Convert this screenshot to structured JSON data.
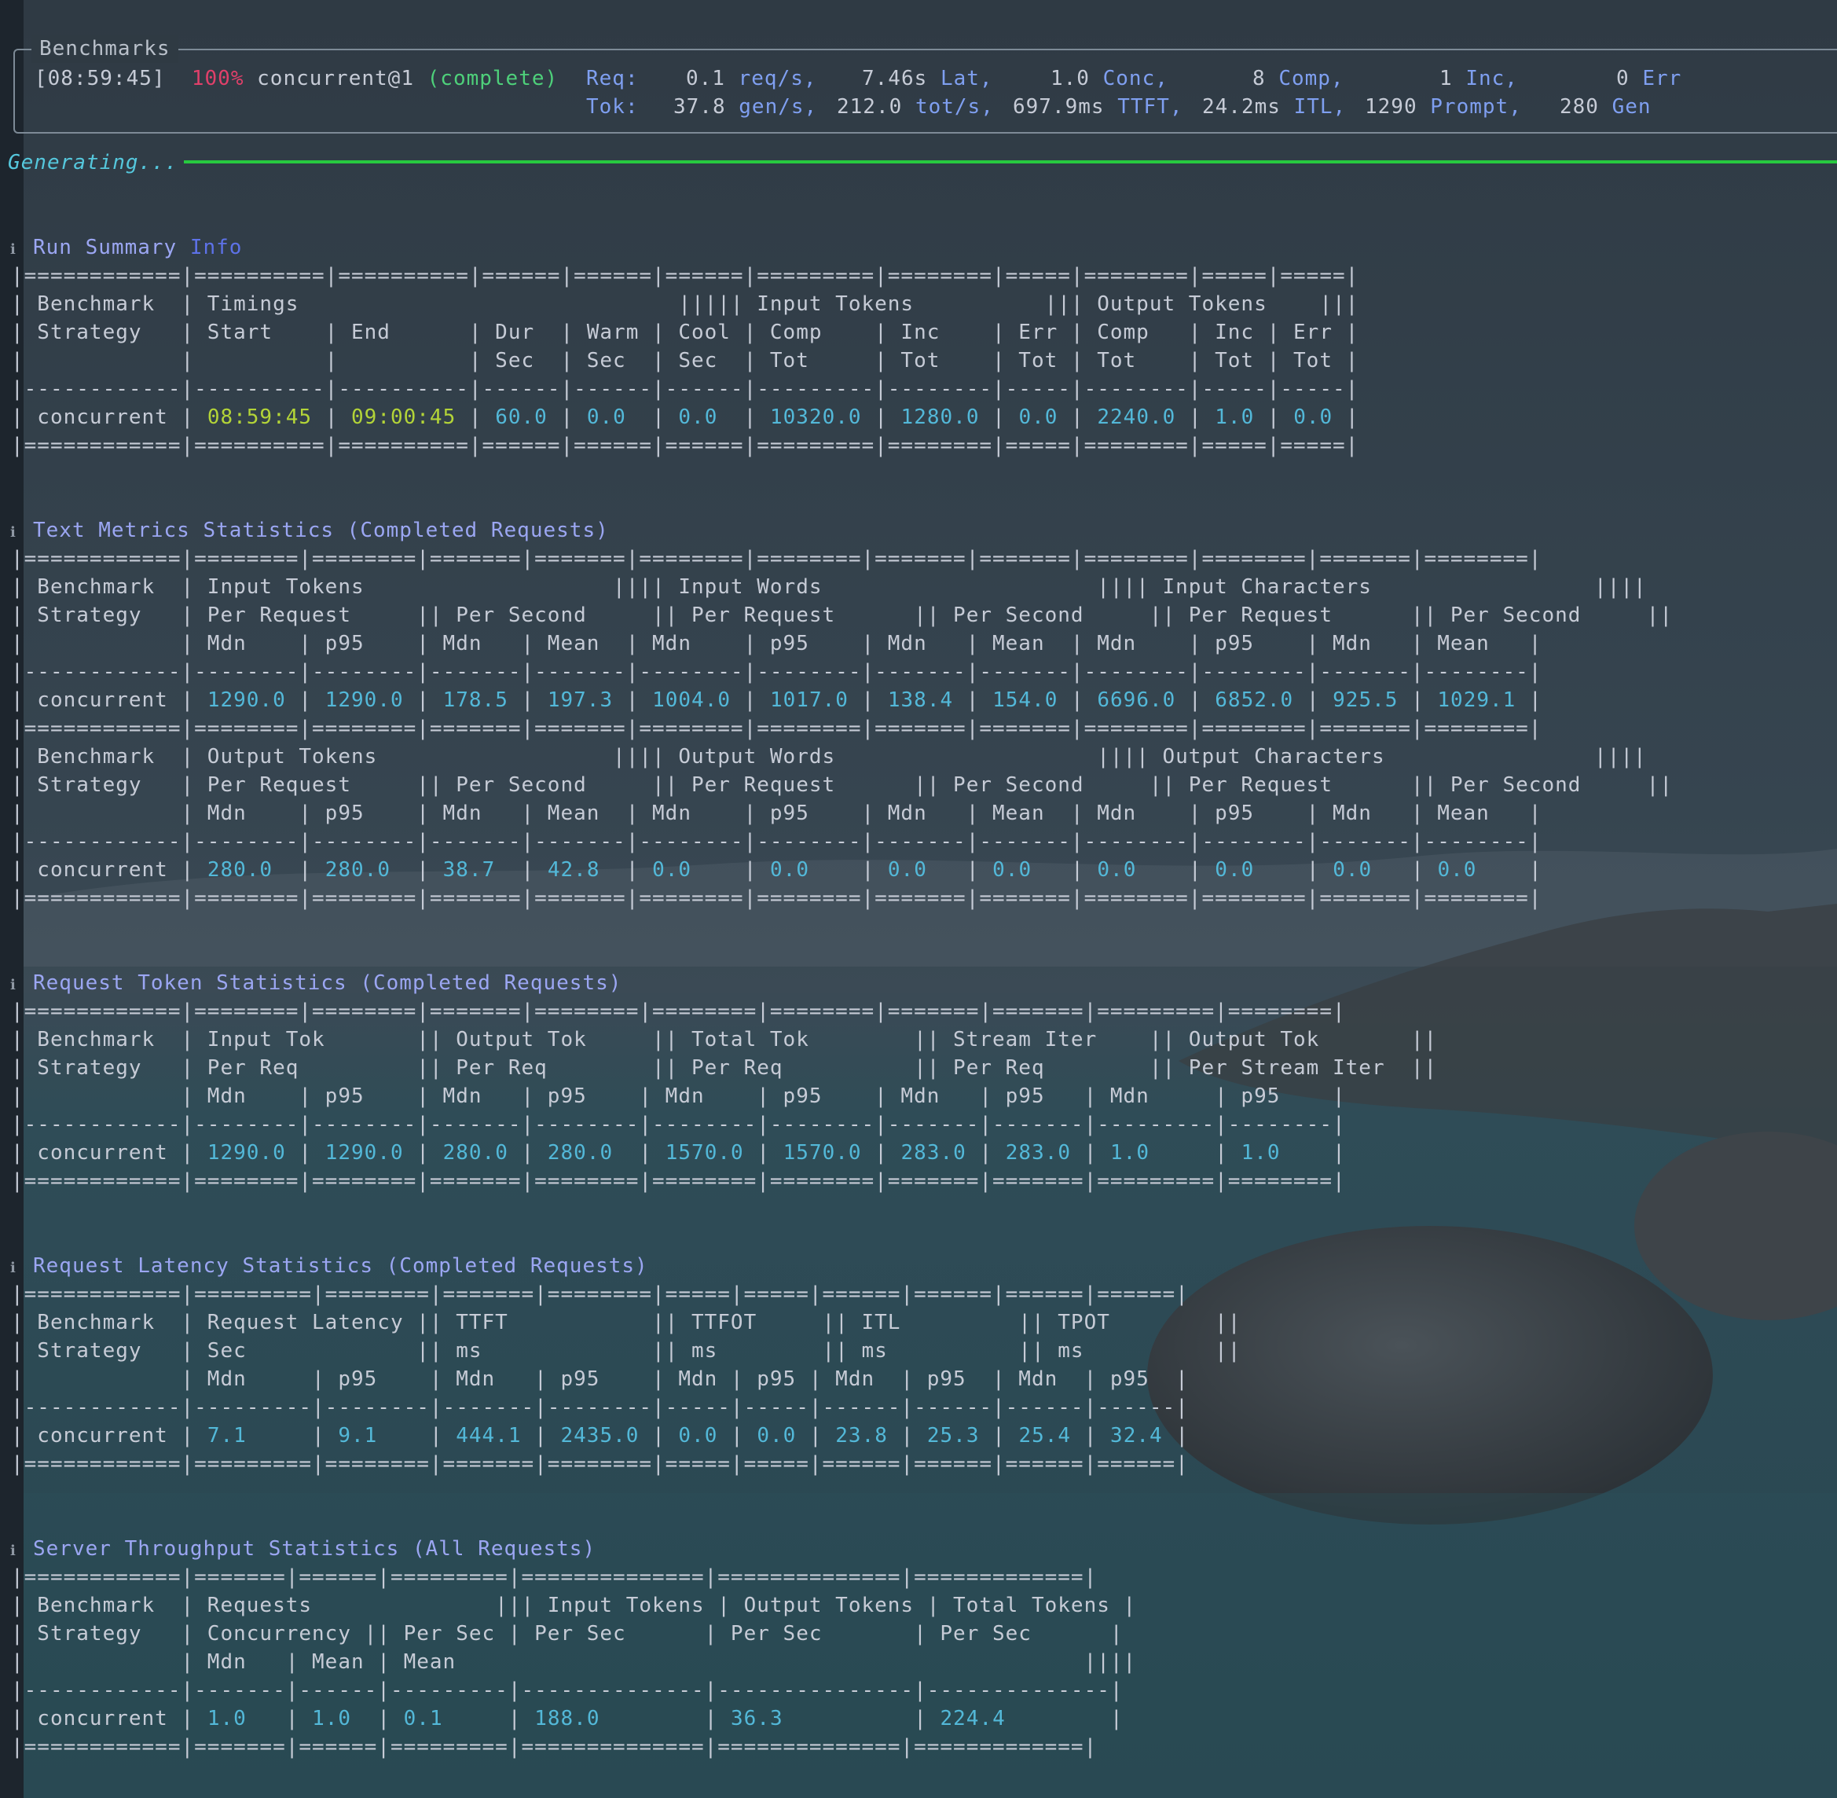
{
  "benchmarks_panel": {
    "title": "Benchmarks",
    "timestamp": "[08:59:45]",
    "progress": "100%",
    "strategy": "concurrent@1",
    "status": "(complete)",
    "req_label": "Req:",
    "req_rate_value": "0.1",
    "req_rate_unit": "req/s,",
    "lat_value": "7.46s",
    "lat_unit": "Lat,",
    "conc_value": "1.0",
    "conc_unit": "Conc,",
    "comp_value": "8",
    "comp_unit": "Comp,",
    "inc_value": "1",
    "inc_unit": "Inc,",
    "err_value": "0",
    "err_unit": "Err",
    "tok_label": "Tok:",
    "gen_rate_value": "37.8",
    "gen_rate_unit": "gen/s,",
    "tot_rate_value": "212.0",
    "tot_rate_unit": "tot/s,",
    "ttft_value": "697.9ms",
    "ttft_unit": "TTFT,",
    "itl_value": "24.2ms",
    "itl_unit": "ITL,",
    "prompt_value": "1290",
    "prompt_unit": "Prompt,",
    "gen_value": "280",
    "gen_unit": "Gen"
  },
  "generating_label": "Generating...",
  "icons": {
    "info": "info-icon"
  },
  "colors": {
    "value": "#53b8d8",
    "time": "#b3d438",
    "title": "#9ba6f2",
    "progress_red": "#e0406a",
    "status_green": "#4ed07a",
    "progress_bar": "#27c93f"
  },
  "sections": {
    "run_summary": {
      "title": "Run Summary",
      "title_suffix": "Info"
    },
    "text_metrics": {
      "title": "Text Metrics Statistics (Completed Requests)"
    },
    "request_tokens": {
      "title": "Request Token Statistics (Completed Requests)"
    },
    "request_latency": {
      "title": "Request Latency Statistics (Completed Requests)"
    },
    "server_throughput": {
      "title": "Server Throughput Statistics (All Requests)"
    }
  },
  "tables": {
    "run_summary": [
      "|============|==========|==========|======|======|======|=========|========|=====|========|=====|=====|",
      "| Benchmark  | Timings                             ||||| Input Tokens          ||| Output Tokens    |||",
      "| Strategy   | Start    | End      | Dur  | Warm | Cool | Comp    | Inc    | Err | Comp   | Inc | Err |",
      "|            |          |          | Sec  | Sec  | Sec  | Tot     | Tot    | Tot | Tot    | Tot | Tot |",
      "|------------|----------|----------|------|------|------|---------|--------|-----|--------|-----|-----|",
      "| concurrent | 08:59:45 | 09:00:45 | 60.0 | 0.0  | 0.0  | 10320.0 | 1280.0 | 0.0 | 2240.0 | 1.0 | 0.0 |",
      "|============|==========|==========|======|======|======|=========|========|=====|========|=====|=====|"
    ],
    "text_metrics": [
      "|============|========|========|=======|=======|========|========|=======|=======|========|========|=======|========|",
      "| Benchmark  | Input Tokens                   |||| Input Words                     |||| Input Characters                 ||||",
      "| Strategy   | Per Request     || Per Second     || Per Request      || Per Second     || Per Request      || Per Second     ||",
      "|            | Mdn    | p95    | Mdn   | Mean  | Mdn    | p95    | Mdn   | Mean  | Mdn    | p95    | Mdn   | Mean   |",
      "|------------|--------|--------|-------|-------|--------|--------|-------|-------|--------|--------|-------|--------|",
      "| concurrent | 1290.0 | 1290.0 | 178.5 | 197.3 | 1004.0 | 1017.0 | 138.4 | 154.0 | 6696.0 | 6852.0 | 925.5 | 1029.1 |",
      "|============|========|========|=======|=======|========|========|=======|=======|========|========|=======|========|",
      "| Benchmark  | Output Tokens                  |||| Output Words                    |||| Output Characters                ||||",
      "| Strategy   | Per Request     || Per Second     || Per Request      || Per Second     || Per Request      || Per Second     ||",
      "|            | Mdn    | p95    | Mdn   | Mean  | Mdn    | p95    | Mdn   | Mean  | Mdn    | p95    | Mdn   | Mean   |",
      "|------------|--------|--------|-------|-------|--------|--------|-------|-------|--------|--------|-------|--------|",
      "| concurrent | 280.0  | 280.0  | 38.7  | 42.8  | 0.0    | 0.0    | 0.0   | 0.0   | 0.0    | 0.0    | 0.0   | 0.0    |",
      "|============|========|========|=======|=======|========|========|=======|=======|========|========|=======|========|"
    ],
    "request_tokens": [
      "|============|========|========|=======|========|========|========|=======|=======|=========|========|",
      "| Benchmark  | Input Tok       || Output Tok     || Total Tok        || Stream Iter    || Output Tok       ||",
      "| Strategy   | Per Req         || Per Req        || Per Req          || Per Req        || Per Stream Iter  ||",
      "|            | Mdn    | p95    | Mdn   | p95    | Mdn    | p95    | Mdn   | p95   | Mdn     | p95    |",
      "|------------|--------|--------|-------|--------|--------|--------|-------|-------|---------|--------|",
      "| concurrent | 1290.0 | 1290.0 | 280.0 | 280.0  | 1570.0 | 1570.0 | 283.0 | 283.0 | 1.0     | 1.0    |",
      "|============|========|========|=======|========|========|========|=======|=======|=========|========|"
    ],
    "request_latency": [
      "|============|=========|========|=======|========|=====|=====|======|======|======|======|",
      "| Benchmark  | Request Latency || TTFT           || TTFOT     || ITL         || TPOT        ||",
      "| Strategy   | Sec             || ms             || ms        || ms          || ms          ||",
      "|            | Mdn     | p95    | Mdn   | p95    | Mdn | p95 | Mdn  | p95  | Mdn  | p95  |",
      "|------------|---------|--------|-------|--------|-----|-----|------|------|------|------|",
      "| concurrent | 7.1     | 9.1    | 444.1 | 2435.0 | 0.0 | 0.0 | 23.8 | 25.3 | 25.4 | 32.4 |",
      "|============|=========|========|=======|========|=====|=====|======|======|======|======|"
    ],
    "server_throughput": [
      "|============|=======|======|=========|==============|==============|=============|",
      "| Benchmark  | Requests              ||| Input Tokens | Output Tokens | Total Tokens |",
      "| Strategy   | Concurrency || Per Sec | Per Sec      | Per Sec       | Per Sec      |",
      "|            | Mdn   | Mean | Mean                                                ||||",
      "|------------|-------|------|---------|--------------|---------------|--------------|",
      "| concurrent | 1.0   | 1.0  | 0.1     | 188.0        | 36.3          | 224.4        |",
      "|============|=======|======|=========|==============|==============|=============|"
    ]
  }
}
